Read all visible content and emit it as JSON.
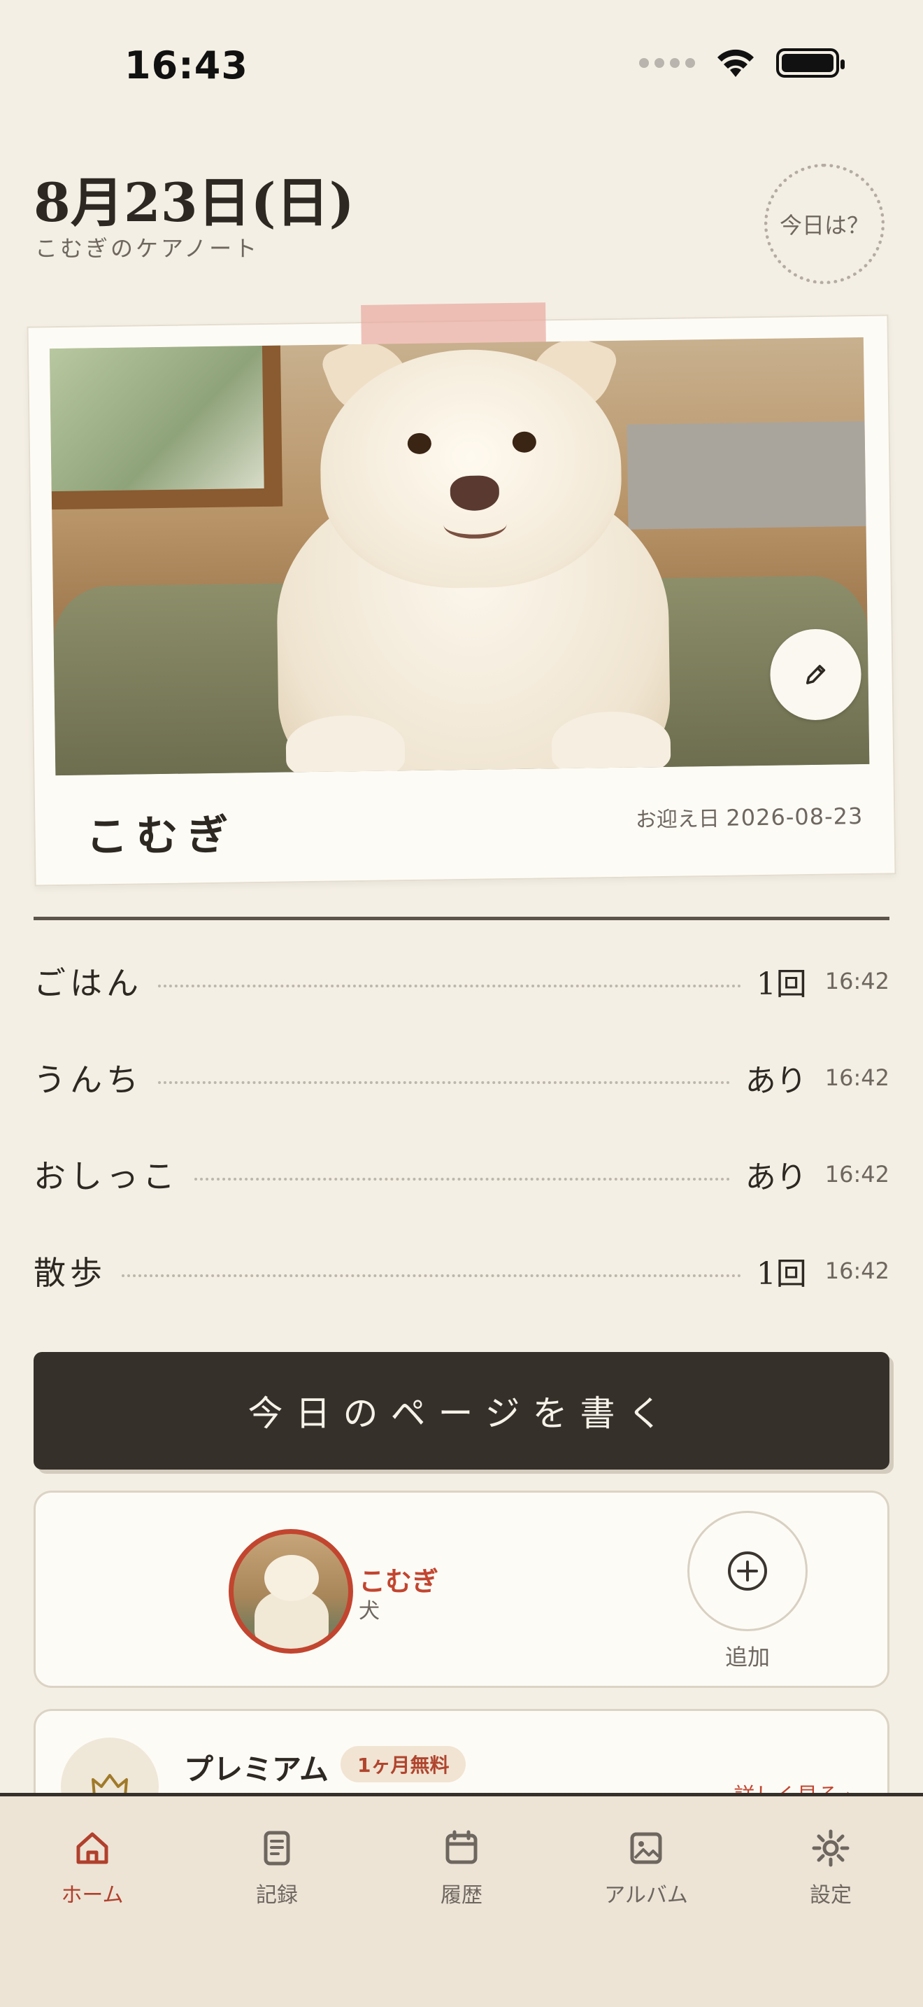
{
  "status_bar": {
    "time": "16:43"
  },
  "header": {
    "date": "8月23日(日)",
    "subtitle": "こむぎのケアノート",
    "today_button": "今日は？"
  },
  "profile": {
    "name": "こむぎ",
    "welcome_label": "お迎え日",
    "welcome_date": "2026-08-23"
  },
  "stats": [
    {
      "label": "ごはん",
      "value": "1回",
      "time": "16:42"
    },
    {
      "label": "うんち",
      "value": "あり",
      "time": "16:42"
    },
    {
      "label": "おしっこ",
      "value": "あり",
      "time": "16:42"
    },
    {
      "label": "散歩",
      "value": "1回",
      "time": "16:42"
    }
  ],
  "write_button": "今日のページを書く",
  "pets": {
    "current": {
      "name": "こむぎ",
      "type": "犬"
    },
    "add_label": "追加"
  },
  "premium": {
    "title": "プレミアム",
    "badge": "1ヶ月無料",
    "link": "詳しく見る ›"
  },
  "tabs": [
    {
      "label": "ホーム",
      "icon": "home-icon",
      "active": true
    },
    {
      "label": "記録",
      "icon": "notebook-icon",
      "active": false
    },
    {
      "label": "履歴",
      "icon": "calendar-icon",
      "active": false
    },
    {
      "label": "アルバム",
      "icon": "photo-icon",
      "active": false
    },
    {
      "label": "設定",
      "icon": "gear-icon",
      "active": false
    }
  ],
  "colors": {
    "background": "#f4efe4",
    "accent": "#c2452f",
    "dark": "#35302a"
  }
}
